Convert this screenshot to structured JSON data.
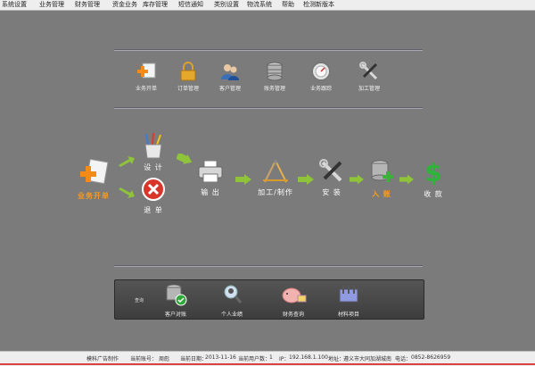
{
  "menu": [
    "系统设置",
    "业务管理",
    "财务管理",
    "资金业务",
    "库存管理",
    "短信通知",
    "类别设置",
    "物流系统",
    "帮助",
    "检测新版本"
  ],
  "toolbar": [
    {
      "label": "业务开单",
      "icon": "order-plus-icon"
    },
    {
      "label": "订单管理",
      "icon": "padlock-icon"
    },
    {
      "label": "客户管理",
      "icon": "users-icon"
    },
    {
      "label": "账务管理",
      "icon": "database-icon"
    },
    {
      "label": "业务跟踪",
      "icon": "gauge-icon"
    },
    {
      "label": "加工管理",
      "icon": "tools-icon"
    }
  ],
  "flow": {
    "start": "业务开单",
    "design": "设  计",
    "void": "退  单",
    "output": "输  出",
    "process": "加工/制作",
    "install": "安  装",
    "stock_in": "入  账",
    "collect": "收  款"
  },
  "query_panel": {
    "title": "查询",
    "items": [
      {
        "label": "客户对账",
        "icon": "ledger-check-icon"
      },
      {
        "label": "个人业绩",
        "icon": "person-search-icon"
      },
      {
        "label": "财务查询",
        "icon": "piggy-bank-icon"
      },
      {
        "label": "材料项目",
        "icon": "materials-icon"
      }
    ]
  },
  "status": {
    "company": "模科广告制作",
    "account_label": "当前账号：",
    "account": "周彪",
    "date_label": "当前日期：",
    "date": "2013-11-16",
    "online_label": "当前用户数：",
    "online": "1",
    "ip_label": "IP：",
    "ip": "192.168.1.100",
    "addr_label": "地址：",
    "addr": "遵义市大同加湖城南",
    "tel_label": "电话：",
    "tel": "0852-8626959"
  }
}
